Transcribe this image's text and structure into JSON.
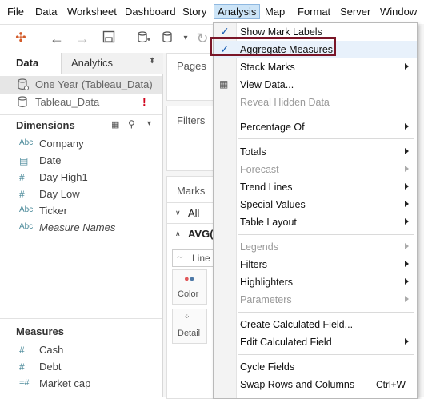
{
  "menubar": {
    "items": [
      "File",
      "Data",
      "Worksheet",
      "Dashboard",
      "Story",
      "Analysis",
      "Map",
      "Format",
      "Server",
      "Window"
    ]
  },
  "left_panel": {
    "tabs": [
      "Data",
      "Analytics"
    ],
    "data_sources": [
      "One Year (Tableau_Data)",
      "Tableau_Data"
    ],
    "warning": "!",
    "dimensions_title": "Dimensions",
    "dimensions": [
      {
        "type": "Abc",
        "label": "Company"
      },
      {
        "type": "date",
        "label": "Date"
      },
      {
        "type": "#",
        "label": "Day High1"
      },
      {
        "type": "#",
        "label": "Day Low"
      },
      {
        "type": "Abc",
        "label": "Ticker"
      },
      {
        "type": "Abc",
        "label": "Measure Names"
      }
    ],
    "measures_title": "Measures",
    "measures": [
      {
        "type": "#",
        "label": "Cash"
      },
      {
        "type": "#",
        "label": "Debt"
      },
      {
        "type": "=#",
        "label": "Market cap"
      }
    ]
  },
  "shelves": {
    "pages": "Pages",
    "filters": "Filters",
    "marks": "Marks",
    "all": "All",
    "avg": "AVG(F",
    "line": "Line",
    "color": "Color",
    "detail": "Detail"
  },
  "analysis_menu": {
    "items": [
      {
        "label": "Show Mark Labels",
        "checked": true
      },
      {
        "label": "Aggregate Measures",
        "checked": true
      },
      {
        "label": "Stack Marks",
        "submenu": true
      },
      {
        "label": "View Data...",
        "icon": "table-icon"
      },
      {
        "label": "Reveal Hidden Data",
        "disabled": true
      },
      {
        "label": "Percentage Of",
        "submenu": true
      },
      {
        "label": "Totals",
        "submenu": true
      },
      {
        "label": "Forecast",
        "submenu": true,
        "disabled": true
      },
      {
        "label": "Trend Lines",
        "submenu": true
      },
      {
        "label": "Special Values",
        "submenu": true
      },
      {
        "label": "Table Layout",
        "submenu": true
      },
      {
        "label": "Legends",
        "submenu": true,
        "disabled": true
      },
      {
        "label": "Filters",
        "submenu": true
      },
      {
        "label": "Highlighters",
        "submenu": true
      },
      {
        "label": "Parameters",
        "submenu": true,
        "disabled": true
      },
      {
        "label": "Create Calculated Field...",
        "submenu": false
      },
      {
        "label": "Edit Calculated Field",
        "submenu": true
      },
      {
        "label": "Cycle Fields"
      },
      {
        "label": "Swap Rows and Columns",
        "shortcut": "Ctrl+W"
      }
    ]
  },
  "colors": {
    "highlight_border": "#7a1628",
    "menu_active_bg": "#cce4f7",
    "check_color": "#1a5fb4"
  }
}
